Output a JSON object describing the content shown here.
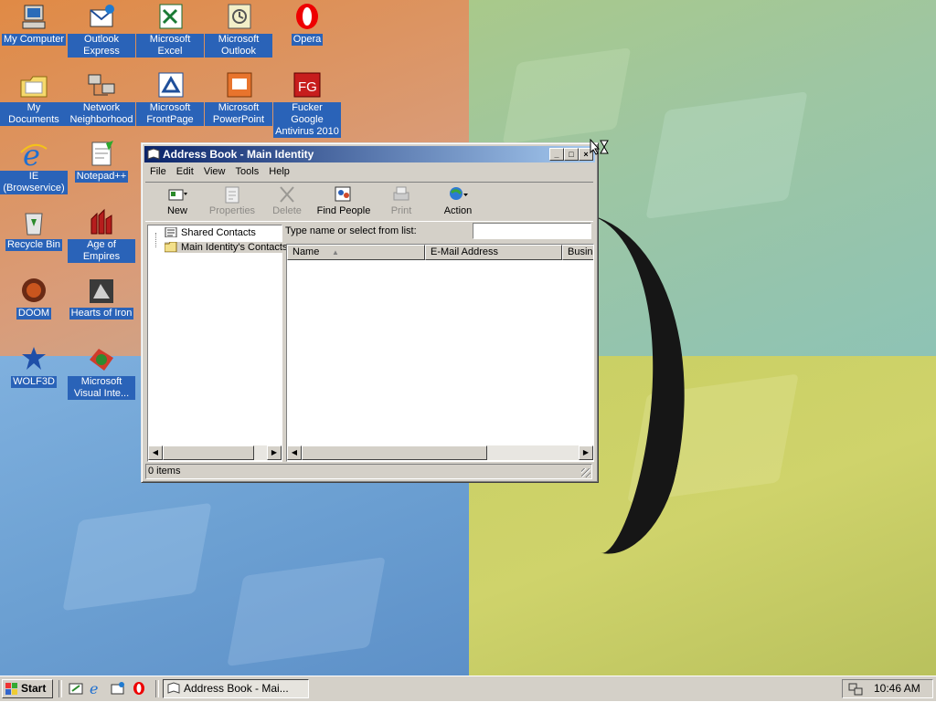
{
  "desktop": {
    "icons": [
      {
        "name": "my-computer",
        "label": "My Computer"
      },
      {
        "name": "outlook-express",
        "label": "Outlook Express"
      },
      {
        "name": "microsoft-excel",
        "label": "Microsoft Excel"
      },
      {
        "name": "microsoft-outlook",
        "label": "Microsoft Outlook"
      },
      {
        "name": "opera",
        "label": "Opera"
      },
      {
        "name": "my-documents",
        "label": "My Documents"
      },
      {
        "name": "network-neighborhood",
        "label": "Network Neighborhood"
      },
      {
        "name": "microsoft-frontpage",
        "label": "Microsoft FrontPage"
      },
      {
        "name": "microsoft-powerpoint",
        "label": "Microsoft PowerPoint"
      },
      {
        "name": "fucker-google-antivirus",
        "label": "Fucker Google Antivirus 2010"
      },
      {
        "name": "ie-browservice",
        "label": "IE (Browservice)"
      },
      {
        "name": "notepad-plus",
        "label": "Notepad++"
      },
      {
        "name": "recycle-bin",
        "label": "Recycle Bin"
      },
      {
        "name": "age-of-empires",
        "label": "Age of Empires"
      },
      {
        "name": "doom",
        "label": "DOOM"
      },
      {
        "name": "hearts-of-iron",
        "label": "Hearts of Iron"
      },
      {
        "name": "wolf3d",
        "label": "WOLF3D"
      },
      {
        "name": "microsoft-visual-inte",
        "label": "Microsoft Visual Inte..."
      }
    ]
  },
  "window": {
    "title": "Address Book - Main Identity",
    "menu": [
      {
        "label": "File"
      },
      {
        "label": "Edit"
      },
      {
        "label": "View"
      },
      {
        "label": "Tools"
      },
      {
        "label": "Help"
      }
    ],
    "toolbar": {
      "new": "New",
      "properties": "Properties",
      "delete": "Delete",
      "find_people": "Find People",
      "print": "Print",
      "action": "Action"
    },
    "tree": {
      "shared": "Shared Contacts",
      "main": "Main Identity's Contacts"
    },
    "find_label": "Type name or select from list:",
    "find_value": "",
    "columns": {
      "name": "Name",
      "email": "E-Mail Address",
      "business": "Business Phone"
    },
    "status": "0 items"
  },
  "taskbar": {
    "start": "Start",
    "task": "Address Book - Mai...",
    "clock": "10:46 AM"
  },
  "colors": {
    "titlebar_start": "#0a246a",
    "titlebar_end": "#a6caf0",
    "face": "#d4d0c8",
    "icon_label_bg": "#2a63b8"
  }
}
